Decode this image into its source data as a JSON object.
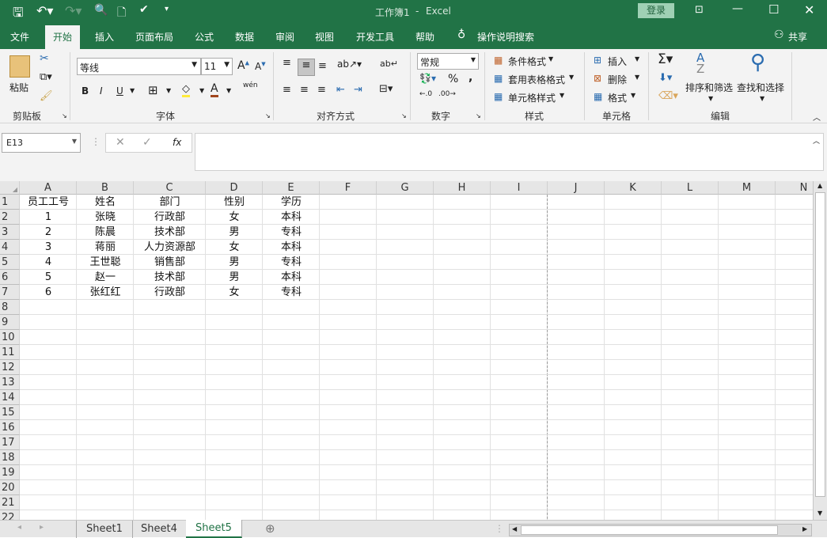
{
  "title": {
    "doc": "工作簿1",
    "sep": "-",
    "app": "Excel",
    "login": "登录"
  },
  "tabs": [
    "文件",
    "开始",
    "插入",
    "页面布局",
    "公式",
    "数据",
    "审阅",
    "视图",
    "开发工具",
    "帮助"
  ],
  "tell_me": "操作说明搜索",
  "share": "共享",
  "ribbon": {
    "clipboard": {
      "paste": "粘贴",
      "group": "剪贴板"
    },
    "font": {
      "name": "等线",
      "size": "11",
      "bold": "B",
      "italic": "I",
      "underline": "U",
      "phonetic": "wén",
      "group": "字体"
    },
    "align": {
      "group": "对齐方式"
    },
    "number": {
      "format": "常规",
      "percent": "%",
      "comma": ",",
      "group": "数字"
    },
    "styles": {
      "cond": "条件格式",
      "table": "套用表格格式",
      "cell": "单元格样式",
      "group": "样式"
    },
    "cells": {
      "insert": "插入",
      "delete": "删除",
      "format": "格式",
      "group": "单元格"
    },
    "editing": {
      "sort": "排序和筛选",
      "find": "查找和选择",
      "group": "编辑"
    }
  },
  "formula_bar": {
    "name_box": "E13",
    "fx": "fx",
    "value": ""
  },
  "columns": [
    "A",
    "B",
    "C",
    "D",
    "E",
    "F",
    "G",
    "H",
    "I",
    "J",
    "K",
    "L",
    "M",
    "N"
  ],
  "rows": [
    "1",
    "2",
    "3",
    "4",
    "5",
    "6",
    "7",
    "8",
    "9",
    "10",
    "11",
    "12",
    "13",
    "14",
    "15",
    "16",
    "17",
    "18",
    "19",
    "20",
    "21",
    "22"
  ],
  "table": [
    [
      "员工工号",
      "姓名",
      "部门",
      "性别",
      "学历"
    ],
    [
      "1",
      "张晓",
      "行政部",
      "女",
      "本科"
    ],
    [
      "2",
      "陈晨",
      "技术部",
      "男",
      "专科"
    ],
    [
      "3",
      "蒋丽",
      "人力资源部",
      "女",
      "本科"
    ],
    [
      "4",
      "王世聪",
      "销售部",
      "男",
      "专科"
    ],
    [
      "5",
      "赵一",
      "技术部",
      "男",
      "本科"
    ],
    [
      "6",
      "张红红",
      "行政部",
      "女",
      "专科"
    ]
  ],
  "sheets": [
    "Sheet1",
    "Sheet4",
    "Sheet5"
  ],
  "active_sheet": "Sheet5"
}
